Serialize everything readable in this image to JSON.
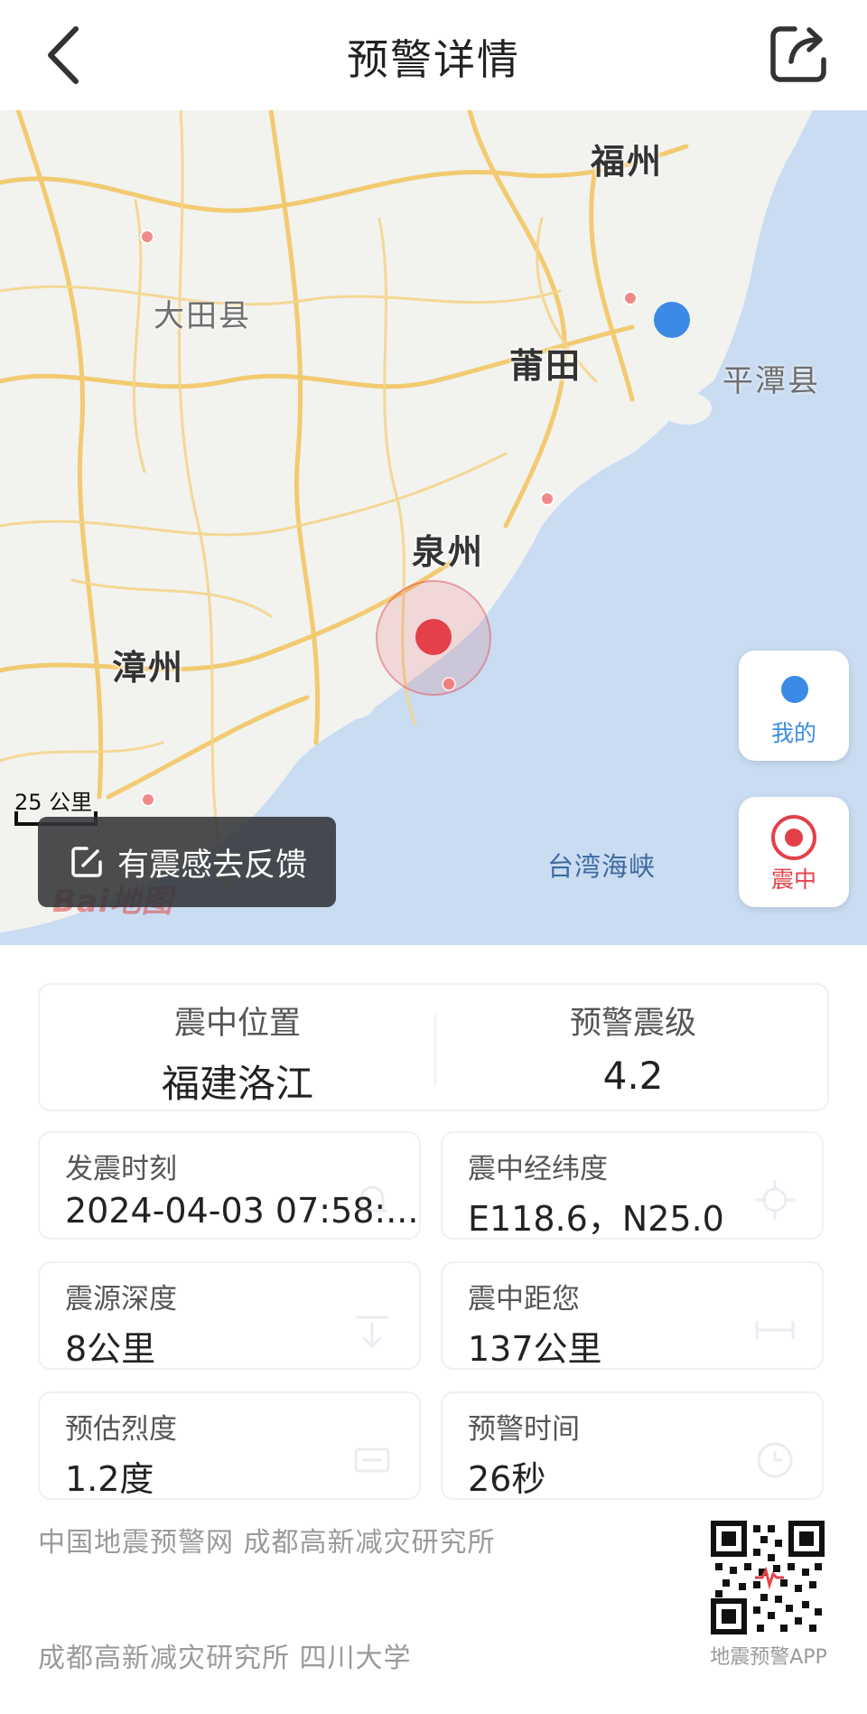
{
  "header": {
    "title": "预警详情",
    "back_icon": "chevron-left-icon",
    "share_icon": "share-icon"
  },
  "map": {
    "cities": [
      {
        "key": "fuzhou",
        "label": "福州"
      },
      {
        "key": "putian",
        "label": "莆田"
      },
      {
        "key": "quanzhou",
        "label": "泉州"
      },
      {
        "key": "zhangzhou",
        "label": "漳州"
      }
    ],
    "counties": [
      {
        "key": "datian",
        "label": "大田县"
      },
      {
        "key": "pingtan",
        "label": "平潭县"
      }
    ],
    "sea_label": "台湾海峡",
    "scale": "25 公里",
    "baidu_logo": "Bai地图",
    "feedback_button": "有震感去反馈",
    "my_location_button": "我的",
    "epicenter_button": "震中",
    "colors": {
      "sea": "#c9dcf2",
      "land": "#f2f2ef",
      "road": "#f2c86a",
      "epicenter": "#e4404a",
      "my_location": "#3c8ae6"
    }
  },
  "summary": {
    "location_label": "震中位置",
    "location_value": "福建洛江",
    "magnitude_label": "预警震级",
    "magnitude_value": "4.2"
  },
  "details": [
    {
      "label": "发震时刻",
      "value": "2024-04-03 07:58:...",
      "icon": "bell-icon"
    },
    {
      "label": "震中经纬度",
      "value": "E118.6，N25.0",
      "icon": "crosshair-icon"
    },
    {
      "label": "震源深度",
      "value": "8公里",
      "icon": "depth-icon"
    },
    {
      "label": "震中距您",
      "value": "137公里",
      "icon": "distance-icon"
    },
    {
      "label": "预估烈度",
      "value": "1.2度",
      "icon": "intensity-icon"
    },
    {
      "label": "预警时间",
      "value": "26秒",
      "icon": "clock-icon"
    }
  ],
  "footer": {
    "source": "中国地震预警网 成都高新减灾研究所",
    "organization": "成都高新减灾研究所 四川大学",
    "qr_label": "地震预警APP"
  }
}
